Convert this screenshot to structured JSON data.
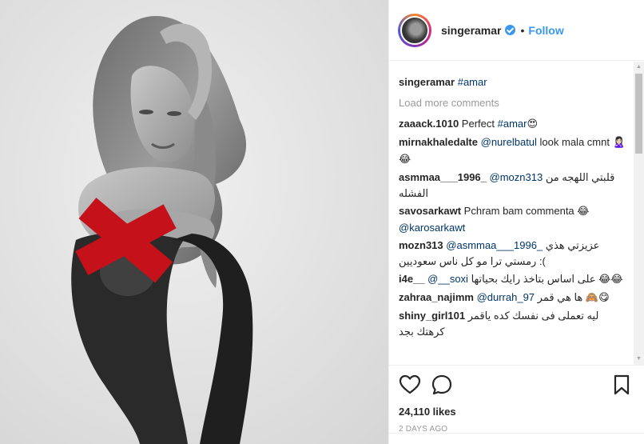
{
  "header": {
    "username": "singeramar",
    "separator": "•",
    "follow_label": "Follow"
  },
  "caption": {
    "username": "singeramar",
    "hashtag": "#amar"
  },
  "load_more_label": "Load more comments",
  "comments": [
    {
      "username": "zaaack.1010",
      "segments": [
        {
          "t": "text",
          "v": " Perfect "
        },
        {
          "t": "tag",
          "v": "#amar"
        },
        {
          "t": "emoji",
          "v": "😍"
        }
      ]
    },
    {
      "username": "mirnakhaledalte",
      "segments": [
        {
          "t": "text",
          "v": " "
        },
        {
          "t": "tag",
          "v": "@nurelbatul"
        },
        {
          "t": "text",
          "v": " look mala cmnt "
        },
        {
          "t": "emoji",
          "v": "🙎🏻‍♀️😂"
        }
      ]
    },
    {
      "username": "asmmaa___1996_",
      "segments": [
        {
          "t": "text",
          "v": " "
        },
        {
          "t": "tag",
          "v": "@mozn313"
        },
        {
          "t": "text",
          "v": " قلبتي اللهجه من الفشله"
        }
      ]
    },
    {
      "username": "savosarkawt",
      "segments": [
        {
          "t": "text",
          "v": " Pchram bam commenta "
        },
        {
          "t": "emoji",
          "v": "😂"
        },
        {
          "t": "text",
          "v": " "
        },
        {
          "t": "tag",
          "v": "@karosarkawt"
        }
      ]
    },
    {
      "username": "mozn313",
      "segments": [
        {
          "t": "text",
          "v": " "
        },
        {
          "t": "tag",
          "v": "@asmmaa___1996_"
        },
        {
          "t": "text",
          "v": " عزيزتي هذي رمستي ترا مو كل ناس سعوديين :("
        }
      ]
    },
    {
      "username": "i4e__",
      "segments": [
        {
          "t": "text",
          "v": " "
        },
        {
          "t": "tag",
          "v": "@__soxi"
        },
        {
          "t": "text",
          "v": " على اساس بتاخذ رايك بحياتها "
        },
        {
          "t": "emoji",
          "v": "😂😂"
        }
      ]
    },
    {
      "username": "zahraa_najimm",
      "segments": [
        {
          "t": "text",
          "v": " "
        },
        {
          "t": "tag",
          "v": "@durrah_97"
        },
        {
          "t": "text",
          "v": " ها هي قمر "
        },
        {
          "t": "emoji",
          "v": "🙈😋"
        }
      ]
    },
    {
      "username": "shiny_girl101",
      "segments": [
        {
          "t": "text",
          "v": " ليه تعملى فى نفسك كده ياقمر كرهتك بجد"
        }
      ]
    }
  ],
  "icons": {
    "like": "heart-icon",
    "comment": "comment-bubble-icon",
    "save": "bookmark-icon",
    "verified": "verified-badge-icon"
  },
  "likes_text": "24,110 likes",
  "time_text": "2 DAYS AGO",
  "colors": {
    "link": "#003569",
    "follow": "#3897f0",
    "censor": "#c4111a"
  }
}
